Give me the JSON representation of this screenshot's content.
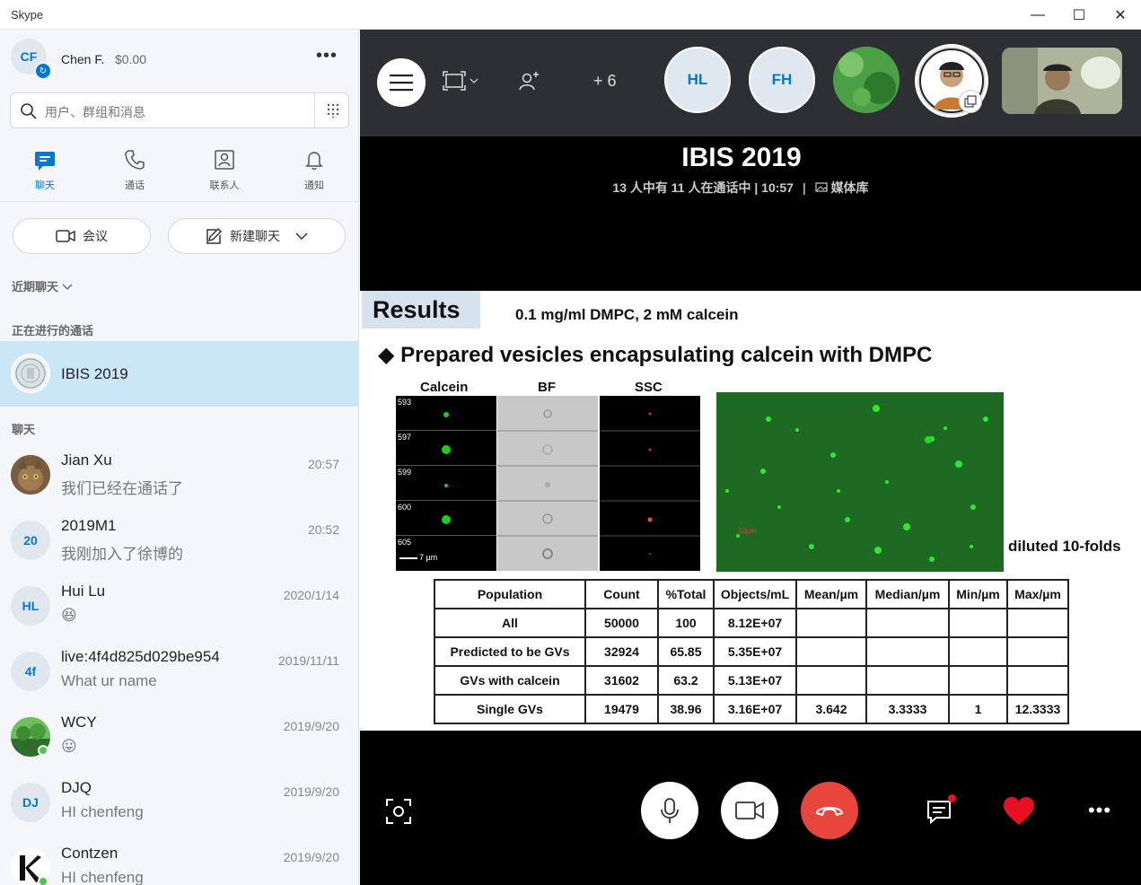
{
  "window": {
    "title": "Skype",
    "minimize": "—",
    "maximize": "☐",
    "close": "✕"
  },
  "profile": {
    "initials": "CF",
    "name": "Chen F.",
    "balance": "$0.00"
  },
  "search": {
    "placeholder": "用户、群组和消息"
  },
  "tabs": [
    {
      "label": "聊天",
      "icon": "chat-icon"
    },
    {
      "label": "通话",
      "icon": "phone-icon"
    },
    {
      "label": "联系人",
      "icon": "contacts-icon"
    },
    {
      "label": "通知",
      "icon": "bell-icon"
    }
  ],
  "buttons": {
    "meeting": "会议",
    "new_chat": "新建聊天"
  },
  "sections": {
    "recent": "近期聊天",
    "ongoing": "正在进行的通话",
    "chats": "聊天"
  },
  "active_call": {
    "name": "IBIS 2019"
  },
  "chats": [
    {
      "name": "Jian Xu",
      "msg": "我们已经在通话了",
      "time": "20:57",
      "initials": ""
    },
    {
      "name": "2019M1",
      "msg": "我刚加入了徐博的",
      "time": "20:52",
      "initials": "20"
    },
    {
      "name": "Hui Lu",
      "msg": "😆",
      "time": "2020/1/14",
      "initials": "HL"
    },
    {
      "name": "live:4f4d825d029be954",
      "msg": "What ur name",
      "time": "2019/11/11",
      "initials": "4f"
    },
    {
      "name": "WCY",
      "msg": "😛",
      "time": "2019/9/20",
      "initials": ""
    },
    {
      "name": "DJQ",
      "msg": "HI chenfeng",
      "time": "2019/9/20",
      "initials": "DJ"
    },
    {
      "name": "Contzen",
      "msg": "HI  chenfeng",
      "time": "2019/9/20",
      "initials": ""
    }
  ],
  "call": {
    "title": "IBIS 2019",
    "subtitle": "13 人中有 11 人在通话中 | 10:57",
    "media_library": "媒体库",
    "add_count": "+ 6",
    "participants": [
      "HL",
      "FH"
    ]
  },
  "slide": {
    "results_label": "Results",
    "subtitle": "0.1 mg/ml DMPC, 2 mM calcein",
    "bullet": "◆ Prepared vesicles encapsulating calcein with DMPC",
    "col_headers": [
      "Calcein",
      "BF",
      "SSC"
    ],
    "row_ids": [
      "593",
      "597",
      "599",
      "600",
      "605"
    ],
    "scale": "7 µm",
    "micro_scale": "10µm",
    "diluted": "diluted 10-folds",
    "table_header": [
      "Population",
      "Count",
      "%Total",
      "Objects/mL",
      "Mean/µm",
      "Median/µm",
      "Min/µm",
      "Max/µm"
    ],
    "table_rows": [
      [
        "All",
        "50000",
        "100",
        "8.12E+07",
        "",
        "",
        "",
        ""
      ],
      [
        "Predicted to be GVs",
        "32924",
        "65.85",
        "5.35E+07",
        "",
        "",
        "",
        ""
      ],
      [
        "GVs with calcein",
        "31602",
        "63.2",
        "5.13E+07",
        "",
        "",
        "",
        ""
      ],
      [
        "Single GVs",
        "19479",
        "38.96",
        "3.16E+07",
        "3.642",
        "3.3333",
        "1",
        "12.3333"
      ]
    ]
  },
  "colors": {
    "accent": "#0078d4",
    "hangup": "#e8453c",
    "heart": "#e81123",
    "active_row": "#cbe7f7"
  }
}
